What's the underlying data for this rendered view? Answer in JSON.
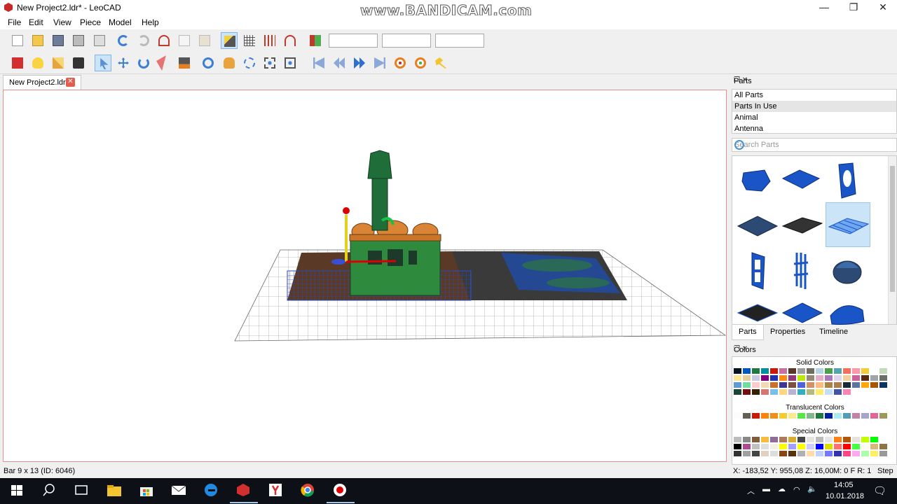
{
  "window": {
    "title": "New Project2.ldr* - LeoCAD",
    "watermark": "www.BANDICAM.com",
    "minimize": "—",
    "maximize": "❐",
    "close": "✕"
  },
  "menu": [
    "File",
    "Edit",
    "View",
    "Piece",
    "Model",
    "Help"
  ],
  "toolbar1": {
    "icons": [
      "new-icon",
      "open-icon",
      "save-icon",
      "print-icon",
      "print-preview-icon",
      "undo-icon",
      "redo-icon",
      "cut-icon",
      "copy-icon",
      "paste-icon",
      "relative-transform-icon",
      "snap-xy-icon",
      "snap-z-icon",
      "snap-angle-icon",
      "transform-icon"
    ],
    "fields": [
      "",
      "",
      ""
    ]
  },
  "toolbar2": {
    "icons": [
      "insert-piece-icon",
      "light-icon",
      "spotlight-icon",
      "camera-icon",
      "select-icon",
      "move-icon",
      "rotate-icon",
      "eraser-icon",
      "paint-icon",
      "zoom-icon",
      "pan-icon",
      "rotate-view-icon",
      "zoom-region-icon",
      "zoom-extents-icon",
      "first-step-icon",
      "previous-step-icon",
      "next-step-icon",
      "last-step-icon",
      "add-step-icon",
      "insert-step-icon",
      "key-frames-icon"
    ]
  },
  "document_tab": {
    "label": "New Project2.ldr",
    "close": "✕"
  },
  "parts_panel": {
    "title": "Parts",
    "categories": [
      "All Parts",
      "Parts In Use",
      "Animal",
      "Antenna"
    ],
    "selected_category": "Parts In Use",
    "search_placeholder": "Search Parts",
    "tabs": [
      "Parts",
      "Properties",
      "Timeline"
    ],
    "active_tab": "Parts"
  },
  "colors_panel": {
    "title": "Colors",
    "groups": [
      "Solid Colors",
      "Translucent Colors",
      "Special Colors"
    ]
  },
  "status": {
    "left": "Bar 9 x 13 (ID: 6046)",
    "coords": "X: -183,52 Y: 955,08 Z: 16,00",
    "step": "M: 0 F R: 1",
    "mode": "Step"
  },
  "taskbar": {
    "time": "14:05",
    "date": "10.01.2018"
  }
}
